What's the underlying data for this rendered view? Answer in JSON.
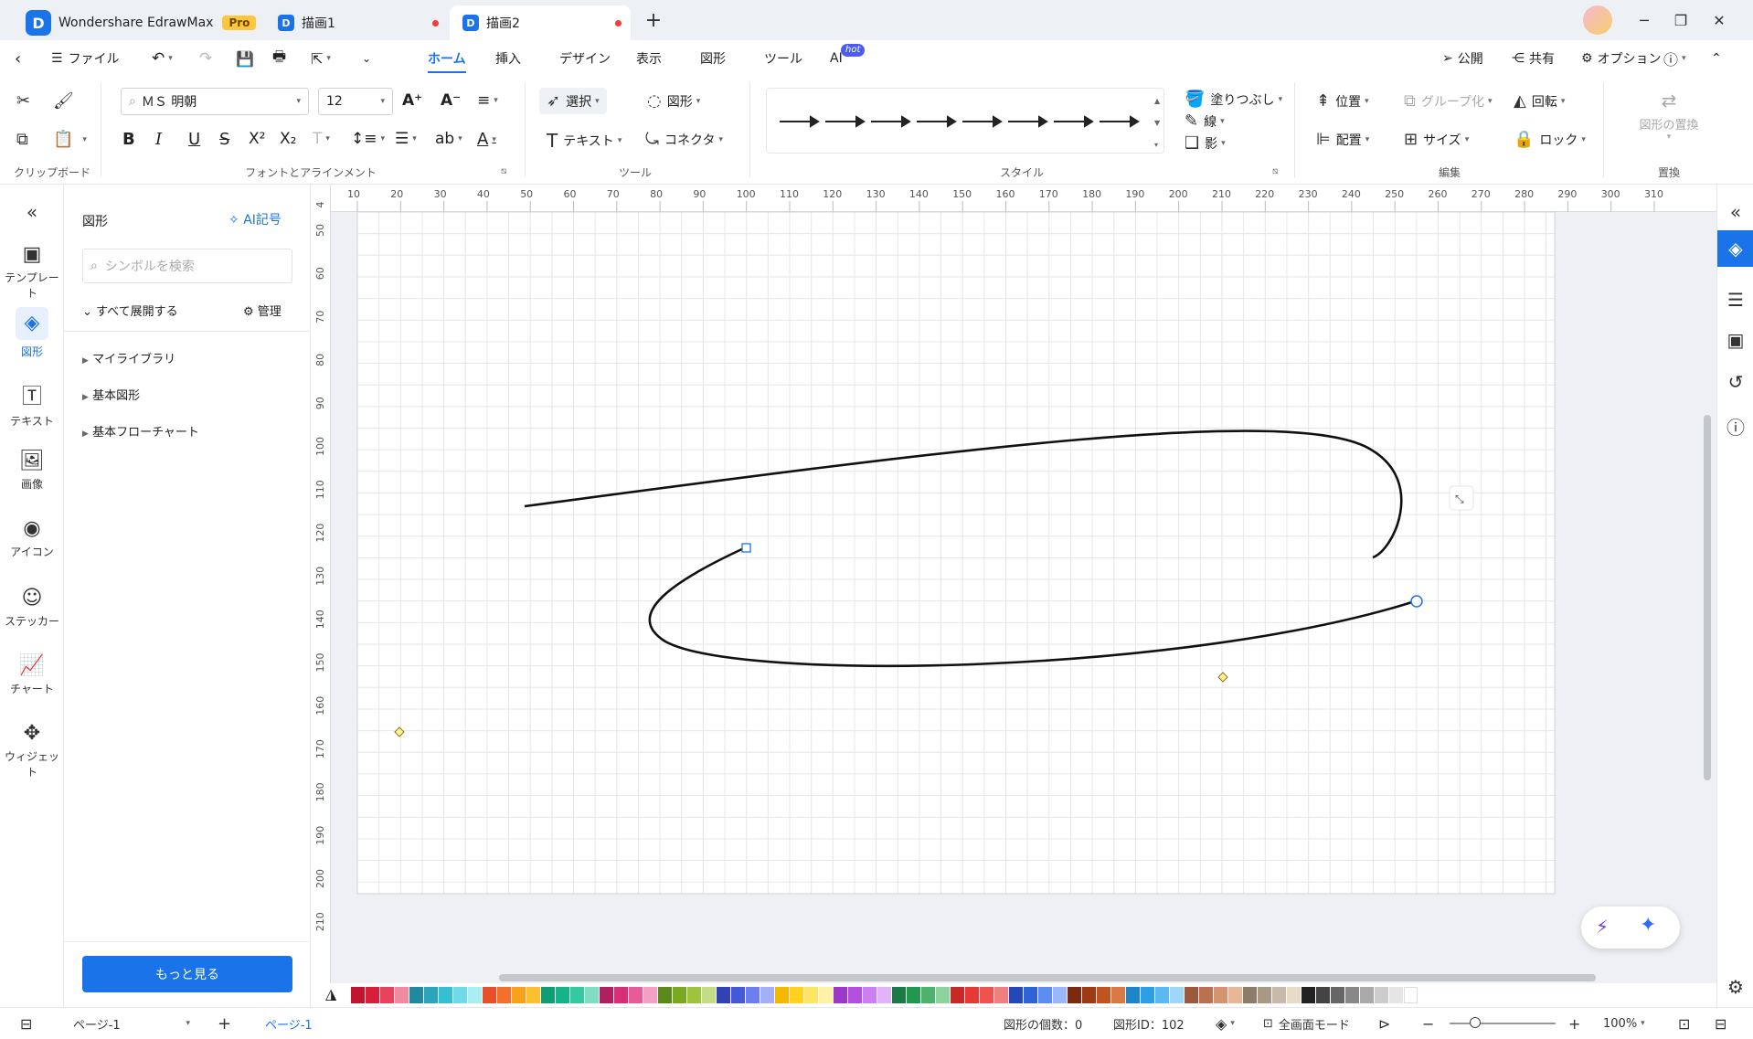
{
  "titlebar": {
    "app_name": "Wondershare EdrawMax",
    "badge": "Pro",
    "tab1": "描画1",
    "tab2": "描画2",
    "new_tab": "+",
    "min": "─",
    "restore": "❐",
    "close": "✕"
  },
  "menubar": {
    "file": "ファイル",
    "items": [
      "ホーム",
      "挿入",
      "デザイン",
      "表示",
      "図形",
      "ツール"
    ],
    "ai": "AI",
    "hot": "hot",
    "publish": "公開",
    "share": "共有",
    "options": "オプション"
  },
  "ribbon": {
    "font_name": "ＭＳ 明朝",
    "font_size": "12",
    "select": "選択",
    "shape": "図形",
    "text": "テキスト",
    "connector": "コネクタ",
    "fill": "塗りつぶし",
    "line": "線",
    "shadow": "影",
    "position": "位置",
    "group": "グループ化",
    "rotate": "回転",
    "align": "配置",
    "size": "サイズ",
    "lock": "ロック",
    "replace_shape": "図形の置換",
    "groups": {
      "clipboard": "クリップボード",
      "font": "フォントとアラインメント",
      "tools": "ツール",
      "style": "スタイル",
      "edit": "編集",
      "replace": "置換"
    }
  },
  "leftbar": [
    {
      "label": "テンプレート",
      "icon": "template-icon"
    },
    {
      "label": "図形",
      "icon": "shapes-icon"
    },
    {
      "label": "テキスト",
      "icon": "text-icon"
    },
    {
      "label": "画像",
      "icon": "image-icon"
    },
    {
      "label": "アイコン",
      "icon": "icon-icon"
    },
    {
      "label": "ステッカー",
      "icon": "sticker-icon"
    },
    {
      "label": "チャート",
      "icon": "chart-icon"
    },
    {
      "label": "ウィジェット",
      "icon": "widget-icon"
    }
  ],
  "panel": {
    "title": "図形",
    "ai_symbol": "AI記号",
    "search_placeholder": "シンボルを検索",
    "expand_all": "すべて展開する",
    "manage": "管理",
    "libraries": [
      "マイライブラリ",
      "基本図形",
      "基本フローチャート"
    ],
    "more": "もっと見る"
  },
  "ruler": {
    "h": [
      "10",
      "20",
      "30",
      "40",
      "50",
      "60",
      "70",
      "80",
      "90",
      "100",
      "110",
      "120",
      "130",
      "140",
      "150",
      "160",
      "170",
      "180",
      "190",
      "200",
      "210",
      "220",
      "230",
      "240",
      "250",
      "260",
      "270",
      "280",
      "290",
      "300",
      "310"
    ],
    "v": [
      "4",
      "50",
      "60",
      "70",
      "80",
      "90",
      "100",
      "110",
      "120",
      "130",
      "140",
      "150",
      "160",
      "170",
      "180",
      "190",
      "200",
      "210"
    ]
  },
  "status": {
    "page_selector": "ページ-1",
    "page_tab": "ページ-1",
    "shape_count": "図形の個数：0",
    "shape_id": "図形ID：102",
    "fullscreen": "全画面モード",
    "zoom": "100%"
  },
  "palette_colors": [
    "#c0142f",
    "#d81e3a",
    "#e8435e",
    "#f08aa0",
    "#1f8a9e",
    "#2aa6b8",
    "#33c0d0",
    "#6fdbe6",
    "#a8eef3",
    "#e8502c",
    "#f26f2c",
    "#f7a21b",
    "#fbc02d",
    "#0f9d76",
    "#13b48a",
    "#35c9a1",
    "#7fddc2",
    "#b01f5f",
    "#d62f78",
    "#e85b99",
    "#f2a0c4",
    "#5a8a1a",
    "#7aa821",
    "#9dc43a",
    "#c4dc86",
    "#3043b5",
    "#4359d8",
    "#6b7ff0",
    "#a3b0f7",
    "#f5b800",
    "#ffd21f",
    "#ffe566",
    "#fff2a8",
    "#9b37c9",
    "#b450e0",
    "#cc7ff0",
    "#e1b3f7",
    "#1b7a45",
    "#23964f",
    "#4cb26c",
    "#8dd3a0",
    "#c62828",
    "#e53935",
    "#ef5350",
    "#f08080",
    "#2348b8",
    "#2d63d6",
    "#5b8ef0",
    "#98b8f7",
    "#7b2a10",
    "#9c3a14",
    "#bf5420",
    "#d97a45",
    "#1d86c9",
    "#2b9fe3",
    "#5ab9f0",
    "#9fd8f7",
    "#9c5a3c",
    "#b87250",
    "#d4946f",
    "#e8b896",
    "#8c7c6a",
    "#a89884",
    "#c7baa8",
    "#e6dcc8",
    "#222222",
    "#444444",
    "#666666",
    "#888888",
    "#aaaaaa",
    "#cccccc",
    "#e5e5e5",
    "#ffffff"
  ]
}
